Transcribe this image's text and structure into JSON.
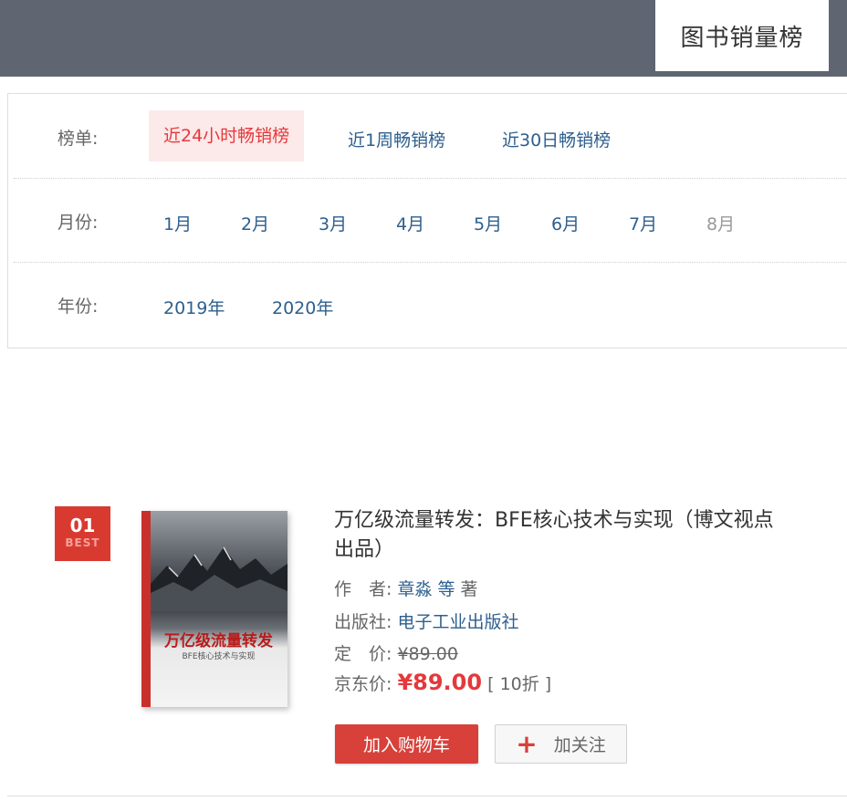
{
  "header": {
    "title": "图书销量榜"
  },
  "filters": {
    "list": {
      "label": "榜单:",
      "options": [
        "近24小时畅销榜",
        "近1周畅销榜",
        "近30日畅销榜"
      ],
      "selected": "近24小时畅销榜"
    },
    "month": {
      "label": "月份:",
      "options": [
        "1月",
        "2月",
        "3月",
        "4月",
        "5月",
        "6月",
        "7月",
        "8月"
      ],
      "disabled": [
        "8月"
      ]
    },
    "year": {
      "label": "年份:",
      "options": [
        "2019年",
        "2020年"
      ]
    }
  },
  "book": {
    "rank": "01",
    "rank_tag": "BEST",
    "title": "万亿级流量转发：BFE核心技术与实现（博文视点出品）",
    "author_label": "作　者:",
    "author": "章淼 等",
    "author_suffix": "著",
    "publisher_label": "出版社:",
    "publisher": "电子工业出版社",
    "list_price_label": "定　价:",
    "list_price": "¥89.00",
    "jd_price_label": "京东价:",
    "jd_price": "¥89.00",
    "discount": "[ 10折 ]",
    "cover_title": "万亿级流量转发",
    "cover_subtitle": "BFE核心技术与实现",
    "add_cart_label": "加入购物车",
    "follow_label": "加关注"
  },
  "colors": {
    "accent": "#e4393c",
    "link": "#2d5f8e",
    "header_bg": "#5f6571"
  }
}
